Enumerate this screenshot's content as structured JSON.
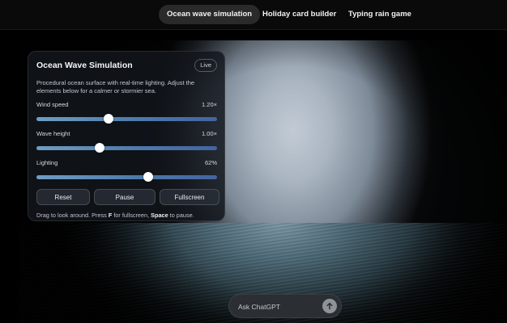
{
  "tabs": [
    {
      "label": "Ocean wave simulation",
      "active": true
    },
    {
      "label": "Holiday card builder",
      "active": false
    },
    {
      "label": "Typing rain game",
      "active": false
    }
  ],
  "panel": {
    "title": "Ocean Wave Simulation",
    "badge": "Live",
    "description": "Procedural ocean surface with real-time lighting. Adjust the elements below for a calmer or stormier sea.",
    "controls": [
      {
        "label": "Wind speed",
        "value": "1.20×",
        "fraction": 0.4
      },
      {
        "label": "Wave height",
        "value": "1.00×",
        "fraction": 0.35
      },
      {
        "label": "Lighting",
        "value": "62%",
        "fraction": 0.62
      }
    ],
    "buttons": {
      "reset": "Reset",
      "pause": "Pause",
      "fullscreen": "Fullscreen"
    },
    "hint": {
      "part1": "Drag to look around. Press ",
      "key1": "F",
      "part2": " for fullscreen, ",
      "key2": "Space",
      "part3": " to pause."
    }
  },
  "ask": {
    "placeholder": "Ask ChatGPT"
  },
  "icons": {
    "send": "arrow-up-icon"
  }
}
